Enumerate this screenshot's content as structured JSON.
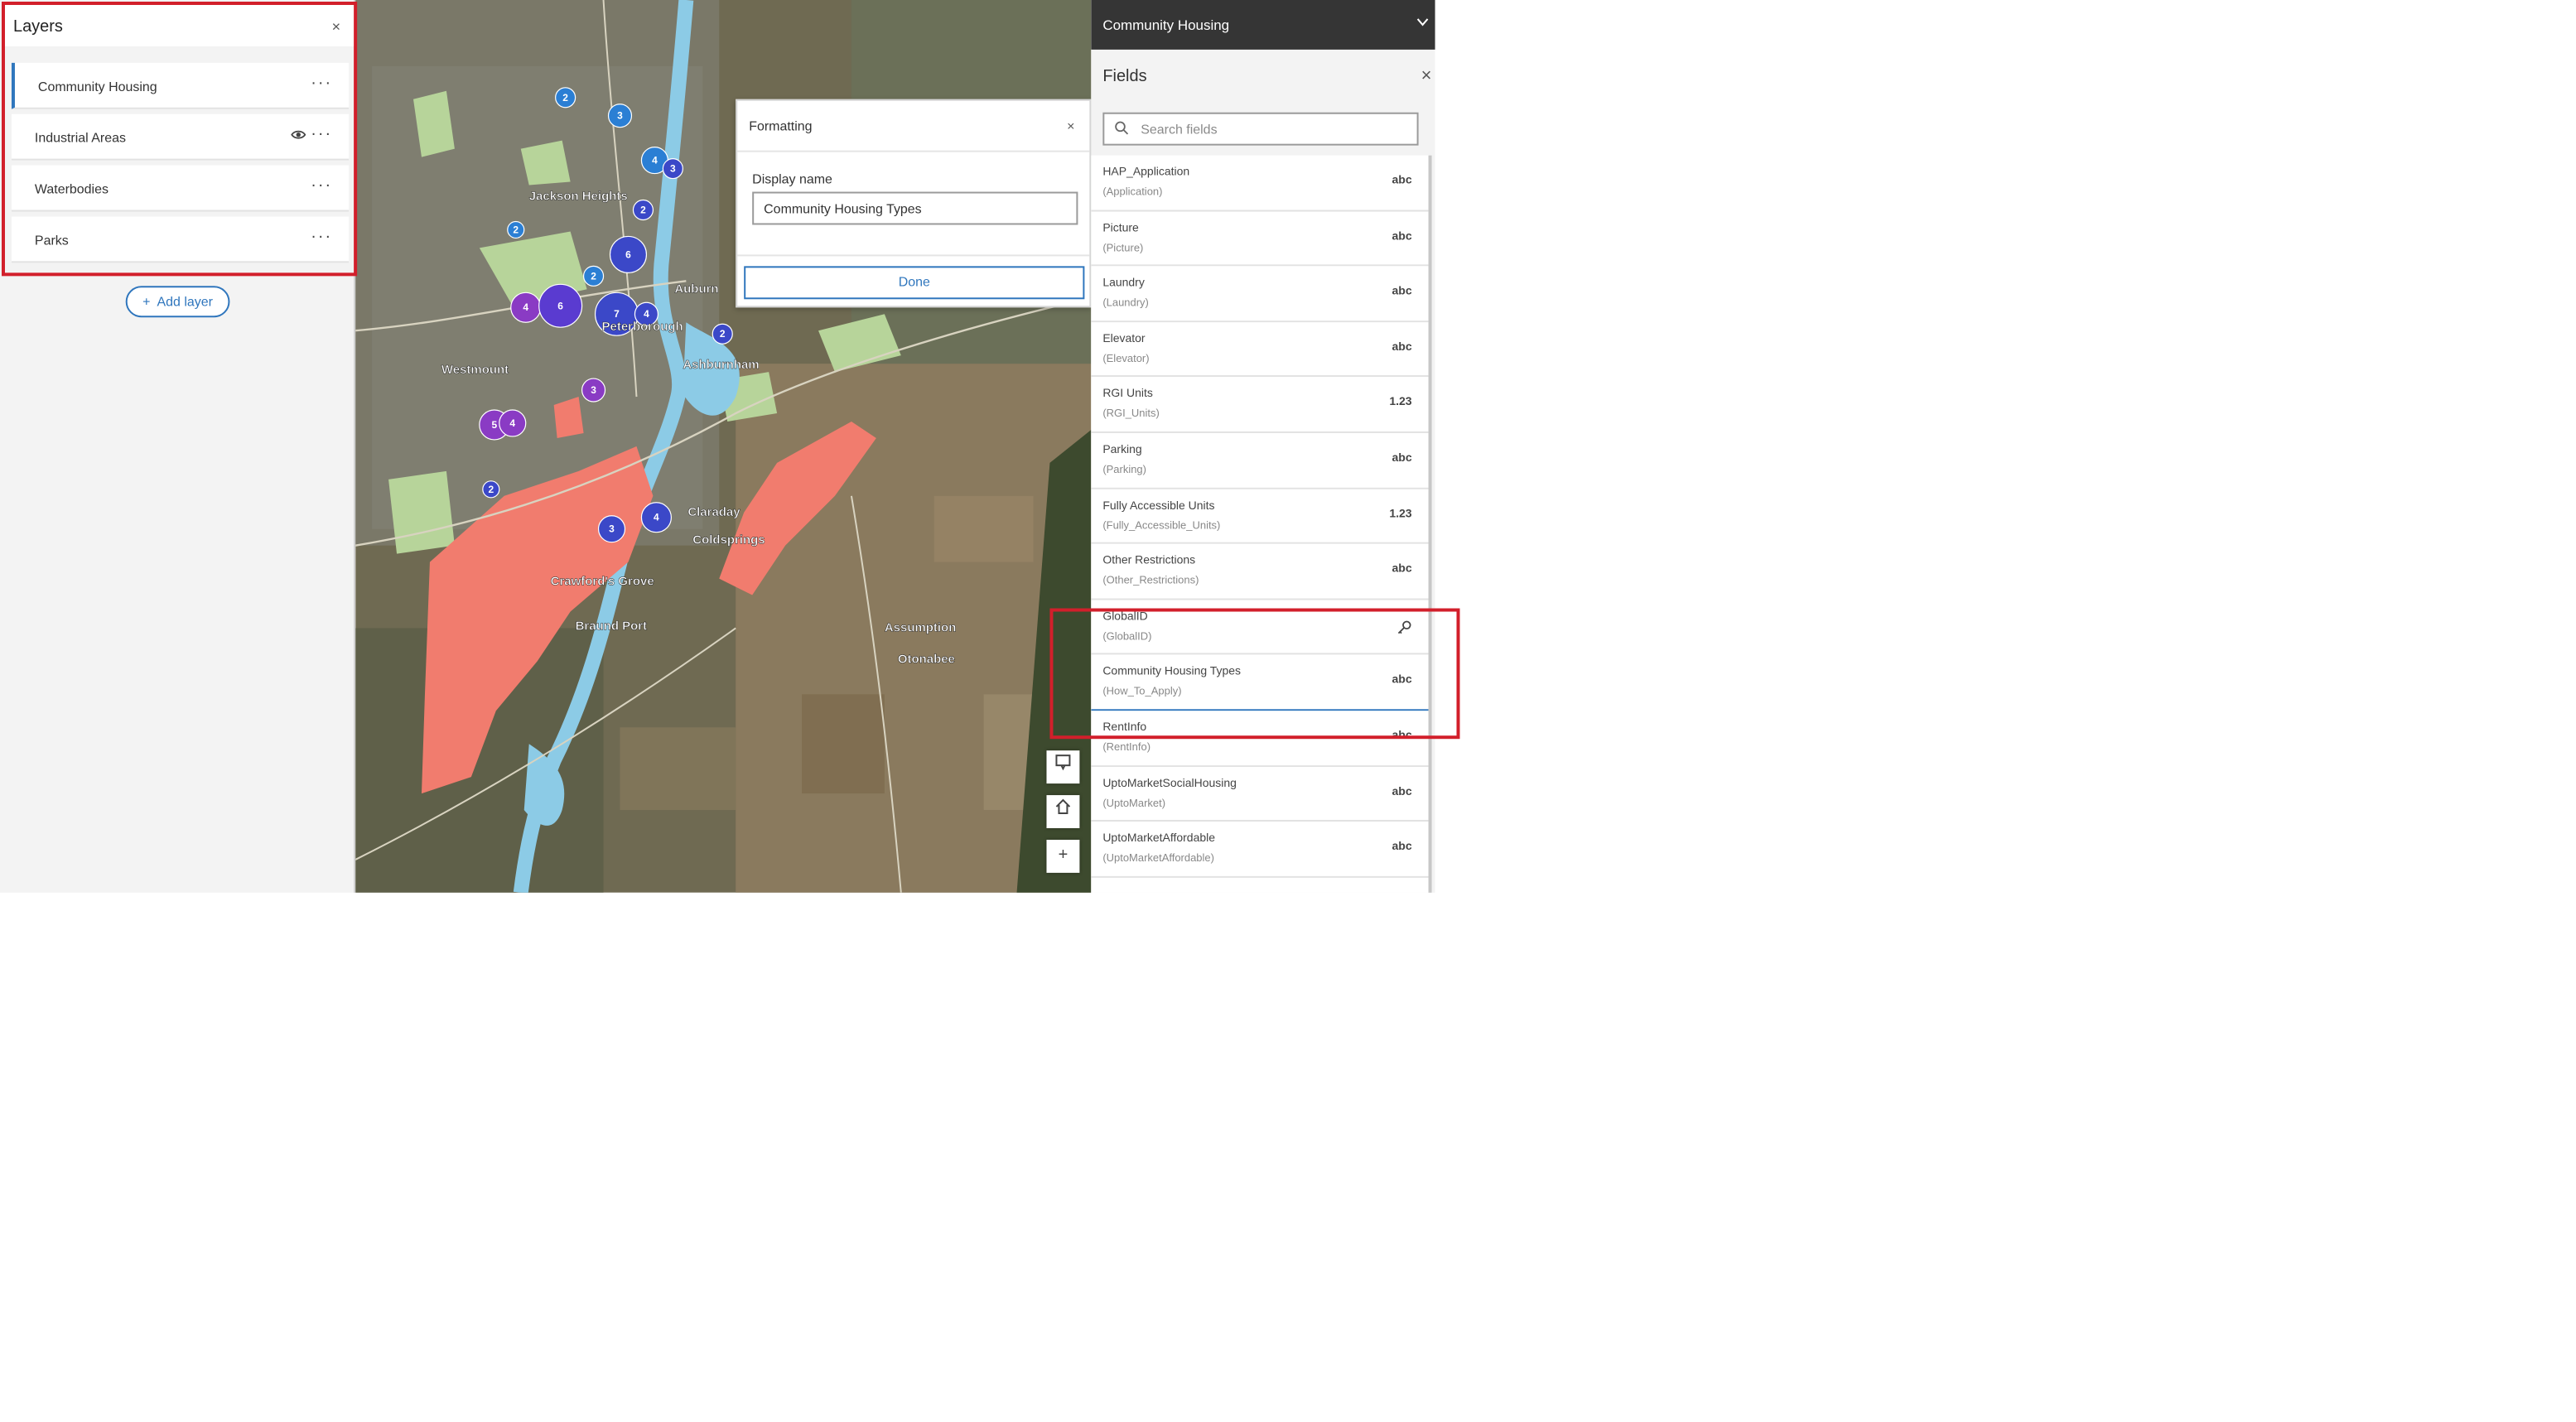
{
  "layers_panel": {
    "title": "Layers",
    "close": "×",
    "items": [
      {
        "label": "Community Housing"
      },
      {
        "label": "Industrial Areas"
      },
      {
        "label": "Waterbodies"
      },
      {
        "label": "Parks"
      }
    ],
    "add_layer": "Add layer"
  },
  "map": {
    "place_labels": [
      "Jackson Heights",
      "Peterborough",
      "Westmount",
      "Ashburnham",
      "Auburn",
      "Otonabee",
      "Assumption",
      "Braund Port",
      "Crawford's Grove",
      "Claraday",
      "Coldsprings"
    ],
    "clusters": [
      "2",
      "3",
      "4",
      "3",
      "6",
      "2",
      "7",
      "4",
      "4",
      "6",
      "2",
      "2",
      "3",
      "5",
      "4",
      "2",
      "3",
      "4",
      "2"
    ]
  },
  "formatting": {
    "title": "Formatting",
    "close": "×",
    "display_name_label": "Display name",
    "display_name_value": "Community Housing Types",
    "done": "Done"
  },
  "right_panel": {
    "header": "Community Housing",
    "fields_title": "Fields",
    "close": "×",
    "search_placeholder": "Search fields",
    "fields": [
      {
        "name": "HAP_Application",
        "alias": "(Application)",
        "type": "abc"
      },
      {
        "name": "Picture",
        "alias": "(Picture)",
        "type": "abc"
      },
      {
        "name": "Laundry",
        "alias": "(Laundry)",
        "type": "abc"
      },
      {
        "name": "Elevator",
        "alias": "(Elevator)",
        "type": "abc"
      },
      {
        "name": "RGI Units",
        "alias": "(RGI_Units)",
        "type": "1.23"
      },
      {
        "name": "Parking",
        "alias": "(Parking)",
        "type": "abc"
      },
      {
        "name": "Fully Accessible Units",
        "alias": "(Fully_Accessible_Units)",
        "type": "1.23"
      },
      {
        "name": "Other Restrictions",
        "alias": "(Other_Restrictions)",
        "type": "abc"
      },
      {
        "name": "GlobalID",
        "alias": "(GlobalID)",
        "type": "key"
      },
      {
        "name": "Community Housing Types",
        "alias": "(How_To_Apply)",
        "type": "abc"
      },
      {
        "name": "RentInfo",
        "alias": "(RentInfo)",
        "type": "abc"
      },
      {
        "name": "UptoMarketSocialHousing",
        "alias": "(UptoMarket)",
        "type": "abc"
      },
      {
        "name": "UptoMarketAffordable",
        "alias": "(UptoMarketAffordable)",
        "type": "abc"
      }
    ]
  },
  "colors": {
    "accent": "#2f76bd",
    "highlight": "#d21f2b",
    "header_bg": "#353535"
  }
}
